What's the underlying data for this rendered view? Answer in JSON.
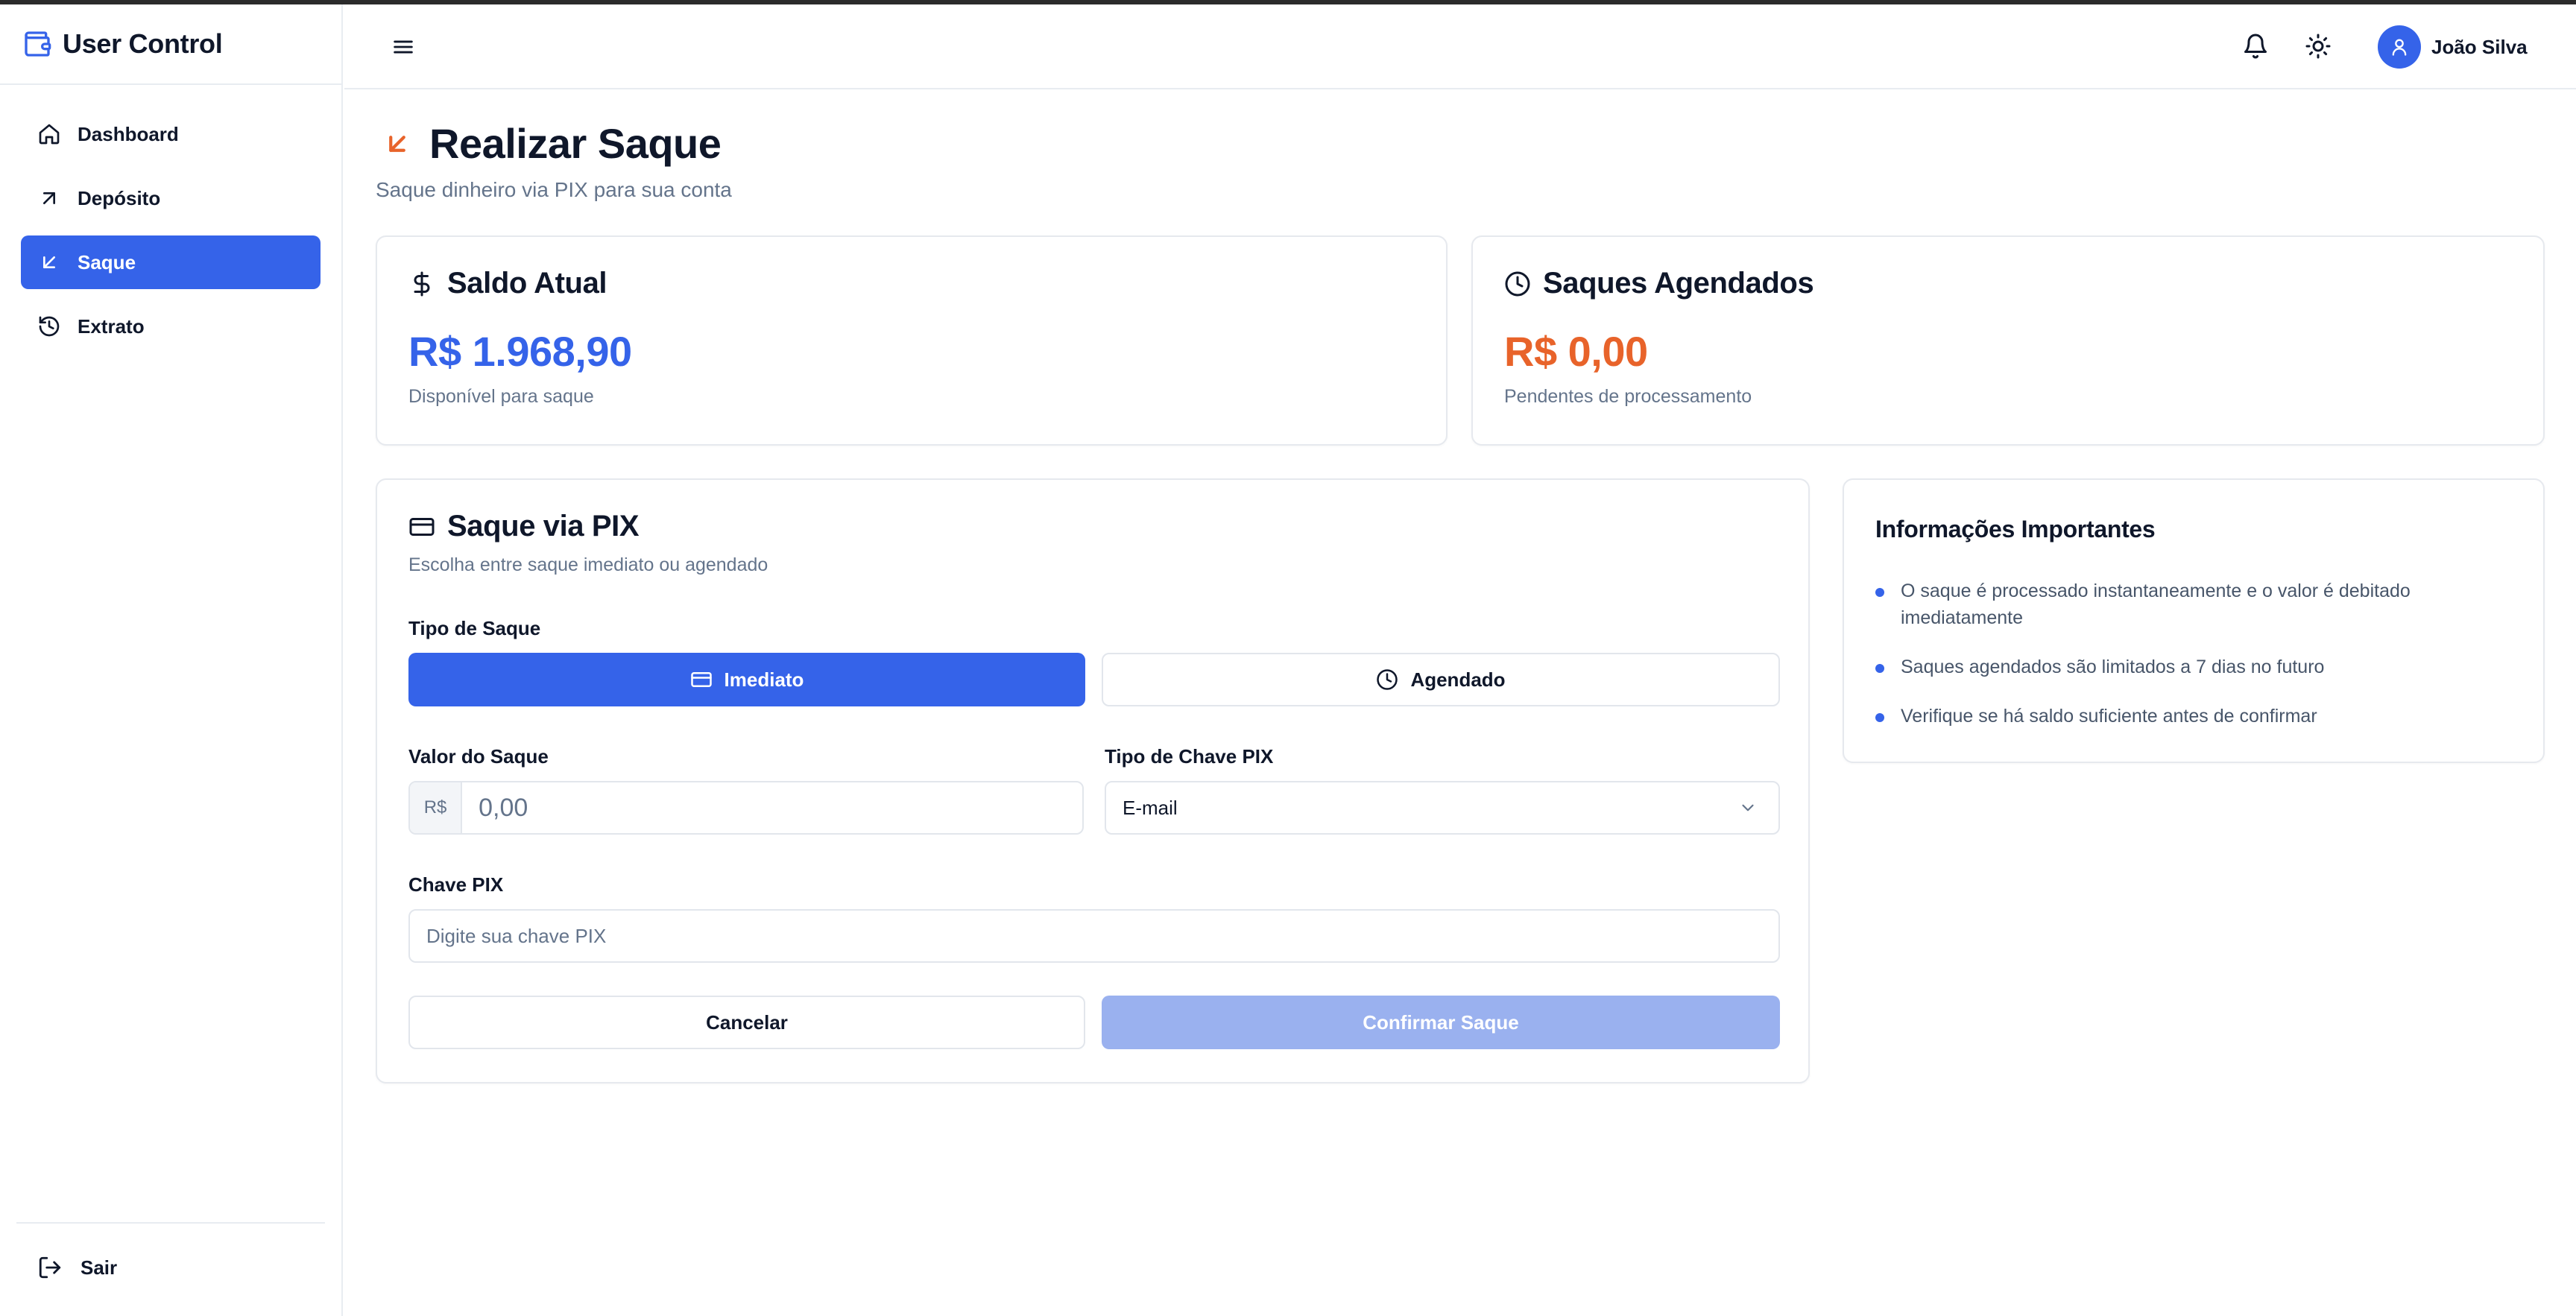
{
  "app": {
    "title": "User Control"
  },
  "sidebar": {
    "items": [
      {
        "label": "Dashboard",
        "icon": "home-icon",
        "active": false
      },
      {
        "label": "Depósito",
        "icon": "arrow-up-right-icon",
        "active": false
      },
      {
        "label": "Saque",
        "icon": "arrow-down-left-icon",
        "active": true
      },
      {
        "label": "Extrato",
        "icon": "history-icon",
        "active": false
      }
    ],
    "logout_label": "Sair"
  },
  "header": {
    "user_name": "João Silva"
  },
  "page": {
    "title": "Realizar Saque",
    "subtitle": "Saque dinheiro via PIX para sua conta"
  },
  "stats": {
    "balance": {
      "title": "Saldo Atual",
      "value": "R$ 1.968,90",
      "desc": "Disponível para saque",
      "color": "#3563e9"
    },
    "scheduled": {
      "title": "Saques Agendados",
      "value": "R$ 0,00",
      "desc": "Pendentes de processamento",
      "color": "#e8632a"
    }
  },
  "form": {
    "title": "Saque via PIX",
    "subtitle": "Escolha entre saque imediato ou agendado",
    "type_label": "Tipo de Saque",
    "type_options": {
      "immediate": "Imediato",
      "scheduled": "Agendado"
    },
    "selected_type": "Imediato",
    "amount_label": "Valor do Saque",
    "amount_prefix": "R$",
    "amount_placeholder": "0,00",
    "amount_value": "",
    "key_type_label": "Tipo de Chave PIX",
    "key_type_value": "E-mail",
    "key_label": "Chave PIX",
    "key_placeholder": "Digite sua chave PIX",
    "key_value": "",
    "cancel_label": "Cancelar",
    "confirm_label": "Confirmar Saque"
  },
  "info": {
    "title": "Informações Importantes",
    "items": [
      "O saque é processado instantaneamente e o valor é debitado imediatamente",
      "Saques agendados são limitados a 7 dias no futuro",
      "Verifique se há saldo suficiente antes de confirmar"
    ]
  },
  "colors": {
    "accent": "#3563e9",
    "warning": "#e8632a",
    "disabled_primary": "#9ab1ef"
  }
}
